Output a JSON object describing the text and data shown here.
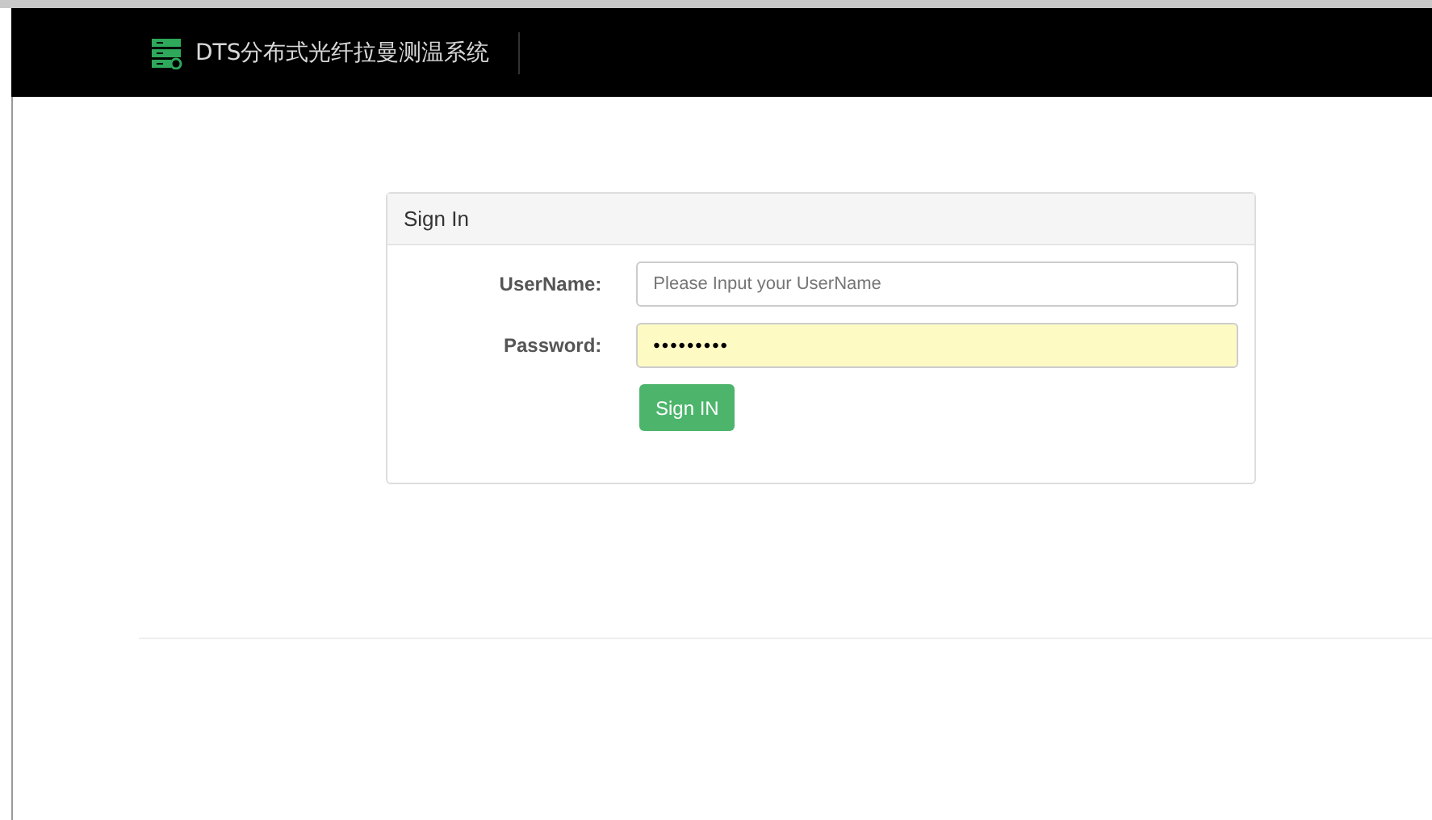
{
  "header": {
    "title": "DTS分布式光纤拉曼测温系统"
  },
  "signin": {
    "heading": "Sign In",
    "fields": [
      {
        "label": "UserName:",
        "placeholder": "Please Input your UserName",
        "autofilled": false
      },
      {
        "label": "Password:",
        "value": "•••••••••",
        "autofilled": true
      }
    ],
    "button": "Sign IN"
  }
}
